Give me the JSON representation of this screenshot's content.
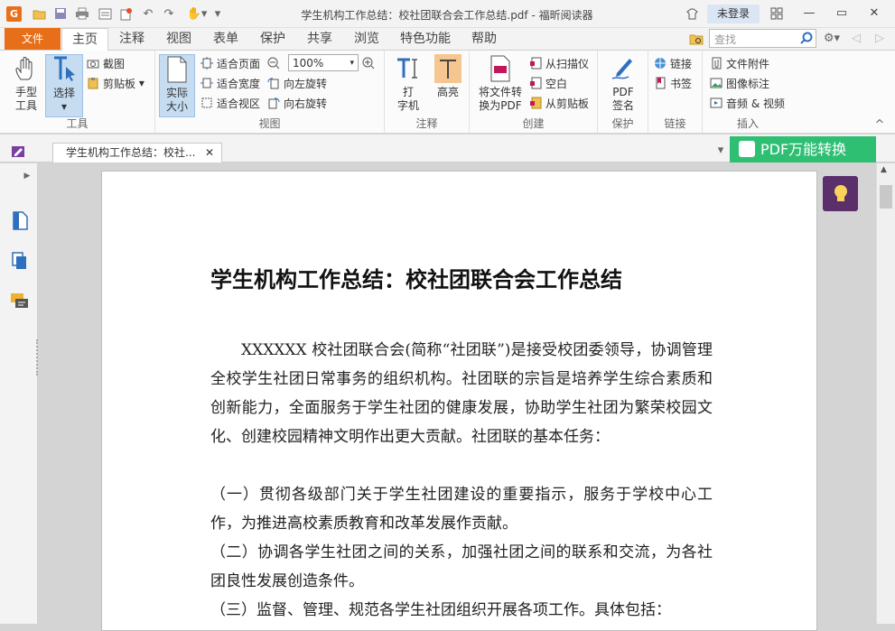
{
  "window": {
    "title": "学生机构工作总结：校社团联合会工作总结.pdf - 福昕阅读器",
    "login_label": "未登录"
  },
  "tabs": {
    "file": "文件",
    "items": [
      "主页",
      "注释",
      "视图",
      "表单",
      "保护",
      "共享",
      "浏览",
      "特色功能",
      "帮助"
    ],
    "active": "主页",
    "search_placeholder": "查找"
  },
  "ribbon": {
    "groups": {
      "tools": "工具",
      "view": "视图",
      "annotate": "注释",
      "create": "创建",
      "protect": "保护",
      "links": "链接",
      "insert": "插入"
    },
    "hand_tool": "手型\n工具",
    "select_tool": "选择",
    "screenshot": "截图",
    "clipboard": "剪贴板",
    "actual_size": "实际\n大小",
    "fit_page": "适合页面",
    "fit_width": "适合宽度",
    "fit_visible": "适合视区",
    "zoom_value": "100%",
    "rotate_left": "向左旋转",
    "rotate_right": "向右旋转",
    "typewriter": "打\n字机",
    "highlight": "高亮",
    "convert_to_pdf": "将文件转\n换为PDF",
    "from_scanner": "从扫描仪",
    "blank": "空白",
    "from_clipboard": "从剪贴板",
    "pdf_sign": "PDF\n签名",
    "link": "链接",
    "bookmark": "书签",
    "file_attachment": "文件附件",
    "image_annotation": "图像标注",
    "audio_video": "音频 & 视频"
  },
  "doc_tab": {
    "label": "学生机构工作总结：校社...",
    "convert_banner": "PDF万能转换"
  },
  "document": {
    "title": "学生机构工作总结：校社团联合会工作总结",
    "paragraphs": [
      "XXXXXX 校社团联合会(简称“社团联”)是接受校团委领导，协调管理全校学生社团日常事务的组织机构。社团联的宗旨是培养学生综合素质和创新能力，全面服务于学生社团的健康发展，协助学生社团为繁荣校园文化、创建校园精神文明作出更大贡献。社团联的基本任务：",
      "（一）贯彻各级部门关于学生社团建设的重要指示，服务于学校中心工作，为推进高校素质教育和改革发展作贡献。",
      "（二）协调各学生社团之间的关系，加强社团之间的联系和交流，为各社团良性发展创造条件。",
      "（三）监督、管理、规范各学生社团组织开展各项工作。具体包括："
    ]
  },
  "colors": {
    "file_tab": "#e86f1a",
    "convert_banner": "#2fbf73",
    "bulb": "#5a2f6a",
    "accent_blue": "#2f6fbf"
  }
}
